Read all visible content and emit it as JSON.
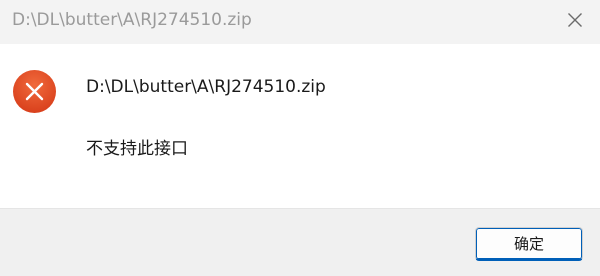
{
  "window": {
    "title": "D:\\DL\\butter\\A\\RJ274510.zip",
    "close_icon": "close-icon"
  },
  "dialog": {
    "icon": "error-icon",
    "path": "D:\\DL\\butter\\A\\RJ274510.zip",
    "message": "不支持此接口",
    "ok_label": "确定"
  },
  "colors": {
    "error_icon": "#e3532a",
    "accent": "#005fb8",
    "titlebar_bg": "#f3f3f3",
    "footer_bg": "#f0f0f0"
  }
}
